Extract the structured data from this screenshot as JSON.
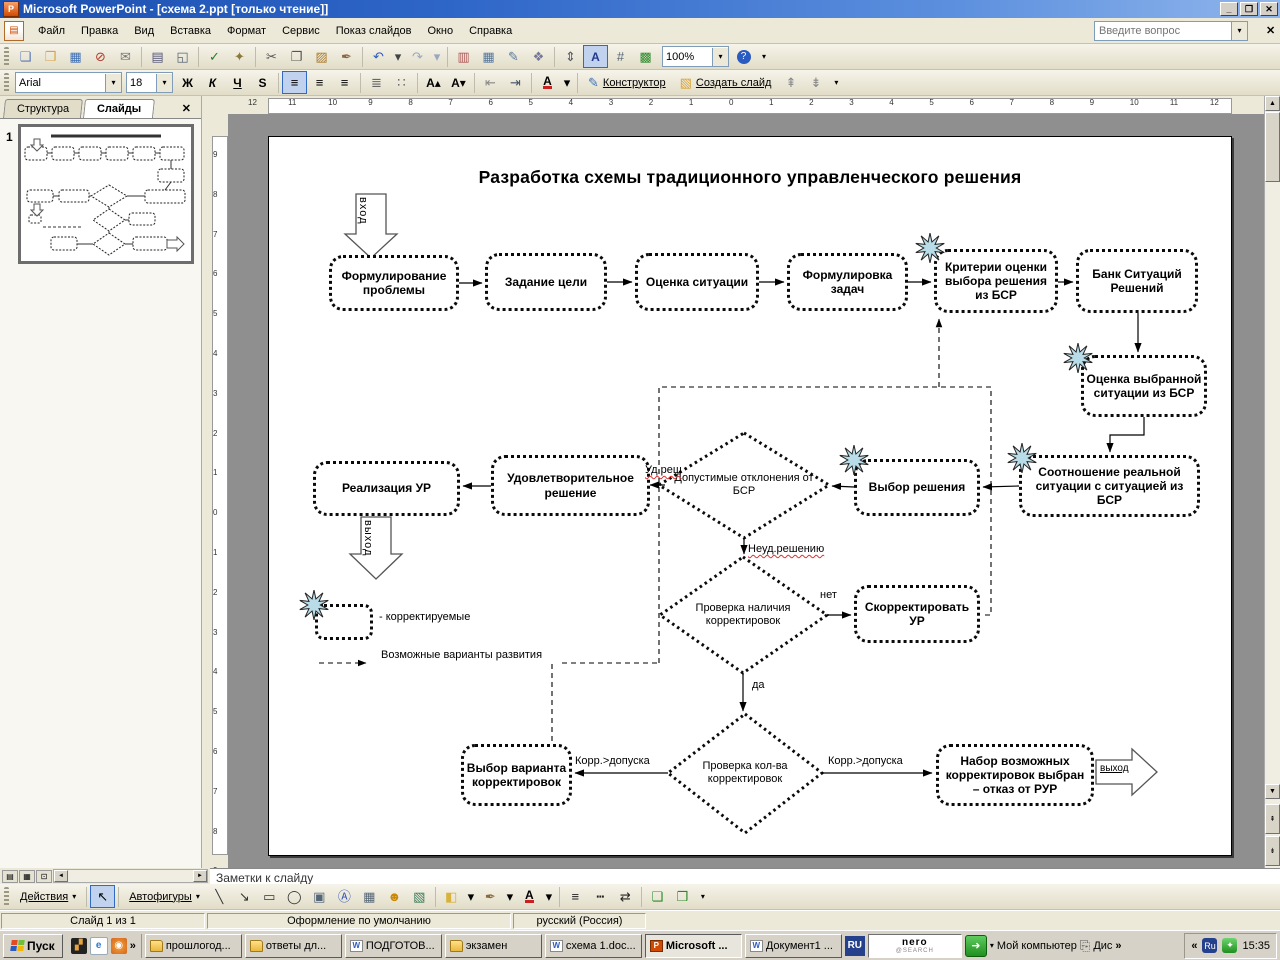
{
  "window": {
    "title": "Microsoft PowerPoint - [схема 2.ppt [только чтение]]"
  },
  "menu": {
    "items": [
      "Файл",
      "Правка",
      "Вид",
      "Вставка",
      "Формат",
      "Сервис",
      "Показ слайдов",
      "Окно",
      "Справка"
    ],
    "question_placeholder": "Введите вопрос"
  },
  "standard_toolbar": {
    "zoom": "100%",
    "buttons": [
      {
        "n": "new-document",
        "g": "❏",
        "c": "#5a77b5"
      },
      {
        "n": "open",
        "g": "❒",
        "c": "#d8a33a"
      },
      {
        "n": "save",
        "g": "▦",
        "c": "#3b6eb5"
      },
      {
        "n": "permission",
        "g": "⊘",
        "c": "#b03a2e"
      },
      {
        "n": "mail",
        "g": "✉",
        "c": "#777777"
      },
      {
        "n": "sep"
      },
      {
        "n": "print",
        "g": "▤",
        "c": "#555577"
      },
      {
        "n": "print-preview",
        "g": "◱",
        "c": "#556677"
      },
      {
        "n": "sep"
      },
      {
        "n": "spelling",
        "g": "✓",
        "c": "#2a7a2a"
      },
      {
        "n": "research",
        "g": "✦",
        "c": "#8a7a3a"
      },
      {
        "n": "sep"
      },
      {
        "n": "cut",
        "g": "✂",
        "c": "#555555"
      },
      {
        "n": "copy",
        "g": "❐",
        "c": "#555555"
      },
      {
        "n": "paste",
        "g": "▨",
        "c": "#a87a2a"
      },
      {
        "n": "format-painter",
        "g": "✒",
        "c": "#886644"
      },
      {
        "n": "sep"
      },
      {
        "n": "undo",
        "g": "↶",
        "c": "#2a5bc0"
      },
      {
        "n": "undo-options",
        "g": "▾",
        "c": "#444444",
        "w": 1
      },
      {
        "n": "redo",
        "g": "↷",
        "c": "#9aa7c0"
      },
      {
        "n": "redo-options",
        "g": "▾",
        "c": "#9aa7c0",
        "w": 1
      },
      {
        "n": "sep"
      },
      {
        "n": "insert-chart",
        "g": "▥",
        "c": "#b05555"
      },
      {
        "n": "insert-table",
        "g": "▦",
        "c": "#557799"
      },
      {
        "n": "draw-table",
        "g": "✎",
        "c": "#557799"
      },
      {
        "n": "insert-object",
        "g": "❖",
        "c": "#777799"
      },
      {
        "n": "sep"
      },
      {
        "n": "line-spacing",
        "g": "⇕",
        "c": "#555566"
      },
      {
        "n": "show-formatting",
        "g": "A",
        "c": "#223a8c",
        "active": 1,
        "cls": "b"
      },
      {
        "n": "grid",
        "g": "#",
        "c": "#556677"
      },
      {
        "n": "color-scheme",
        "g": "▩",
        "c": "#2a8a2a"
      }
    ]
  },
  "formatting_toolbar": {
    "font": "Arial",
    "size": "18",
    "design_label": "Конструктор",
    "new_slide_label": "Создать слайд",
    "buttons": [
      {
        "n": "bold",
        "g": "Ж",
        "cls": "b"
      },
      {
        "n": "italic",
        "g": "К",
        "cls": "i"
      },
      {
        "n": "underline",
        "g": "Ч",
        "cls": "u"
      },
      {
        "n": "text-shadow",
        "g": "S",
        "cls": "b"
      },
      {
        "n": "sep"
      },
      {
        "n": "align-left",
        "g": "≡",
        "active": 1
      },
      {
        "n": "align-center",
        "g": "≡"
      },
      {
        "n": "align-right",
        "g": "≡"
      },
      {
        "n": "sep"
      },
      {
        "n": "numbering",
        "g": "≣",
        "c": "#666666"
      },
      {
        "n": "bullets",
        "g": "∷",
        "c": "#666666"
      },
      {
        "n": "sep"
      },
      {
        "n": "increase-font-size",
        "g": "A▴",
        "cls": "b"
      },
      {
        "n": "decrease-font-size",
        "g": "A▾",
        "cls": "b"
      },
      {
        "n": "sep"
      },
      {
        "n": "decrease-indent",
        "g": "⇤",
        "c": "#888888"
      },
      {
        "n": "increase-indent",
        "g": "⇥",
        "c": "#445566"
      },
      {
        "n": "sep"
      },
      {
        "n": "font-color",
        "g": "А",
        "cls": "fc"
      },
      {
        "n": "font-color-options",
        "g": "▾",
        "w": 1
      }
    ]
  },
  "drawing_toolbar": {
    "actions_label": "Действия",
    "autoshapes_label": "Автофигуры",
    "buttons": [
      {
        "n": "line",
        "g": "╲",
        "c": "#333333"
      },
      {
        "n": "arrow",
        "g": "↘",
        "c": "#333333"
      },
      {
        "n": "rectangle",
        "g": "▭",
        "c": "#333333"
      },
      {
        "n": "oval",
        "g": "◯",
        "c": "#333333"
      },
      {
        "n": "text-box",
        "g": "▣",
        "c": "#556677"
      },
      {
        "n": "wordart",
        "g": "Ⓐ",
        "c": "#3355bb"
      },
      {
        "n": "insert-diagram",
        "g": "▦",
        "c": "#556677"
      },
      {
        "n": "clip-art",
        "g": "☻",
        "c": "#cc8800"
      },
      {
        "n": "insert-picture",
        "g": "▧",
        "c": "#3a7a5a"
      },
      {
        "n": "sep"
      },
      {
        "n": "fill-color",
        "g": "◧",
        "c": "#d8b23a"
      },
      {
        "n": "fill-color-options",
        "g": "▾",
        "w": 1
      },
      {
        "n": "line-color",
        "g": "✒",
        "c": "#8a6a3a"
      },
      {
        "n": "line-color-options",
        "g": "▾",
        "w": 1
      },
      {
        "n": "font-color-draw",
        "g": "А",
        "cls": "fc"
      },
      {
        "n": "font-color-draw-options",
        "g": "▾",
        "w": 1
      },
      {
        "n": "sep"
      },
      {
        "n": "line-style",
        "g": "≡",
        "c": "#222222"
      },
      {
        "n": "dash-style",
        "g": "┅",
        "c": "#222222"
      },
      {
        "n": "arrow-style",
        "g": "⇄",
        "c": "#222222"
      },
      {
        "n": "sep"
      },
      {
        "n": "shadow-style",
        "g": "❏",
        "c": "#2a8a2a"
      },
      {
        "n": "3d-style",
        "g": "❒",
        "c": "#2a8a2a"
      }
    ]
  },
  "panes": {
    "tabs": [
      {
        "label": "Структура"
      },
      {
        "label": "Слайды"
      }
    ],
    "slide_number": "1"
  },
  "rulers": {
    "horizontal": [
      "12",
      "11",
      "10",
      "9",
      "8",
      "7",
      "6",
      "5",
      "4",
      "3",
      "2",
      "1",
      "0",
      "1",
      "2",
      "3",
      "4",
      "5",
      "6",
      "7",
      "8",
      "9",
      "10",
      "11",
      "12"
    ],
    "vertical": [
      "9",
      "8",
      "7",
      "6",
      "5",
      "4",
      "3",
      "2",
      "1",
      "0",
      "1",
      "2",
      "3",
      "4",
      "5",
      "6",
      "7",
      "8",
      "9"
    ]
  },
  "diagram": {
    "title": "Разработка схемы традиционного управленческого решения",
    "entry_label": "вход",
    "exit_down_label": "выход",
    "exit_right_label": "выход",
    "nodes": {
      "formulate_problem": "Формулирование проблемы",
      "set_goal": "Задание цели",
      "assess_situation": "Оценка ситуации",
      "formulate_tasks": "Формулировка задач",
      "criteria": "Критерии оценки выбора решения из БСР",
      "bank": "Банк Ситуаций Решений",
      "evaluate_selected": "Оценка выбранной ситуации из БСР",
      "correlation": "Соотношение реальной ситуации с ситуацией из БСР",
      "implementation": "Реализация УР",
      "satisfactory": "Удовлетворительное решение",
      "allowable_deviations": "Допустимые отклонения от БСР",
      "choose_solution": "Выбор решения",
      "check_corrections": "Проверка наличия корректировок",
      "adjust": "Скорректировать УР",
      "check_quantity": "Проверка кол-ва корректировок",
      "choose_correction_variant": "Выбор варианта корректировок",
      "correction_set": "Набор возможных корректировок выбран – отказ от РУР"
    },
    "labels": {
      "satisfied": "Уд.реш",
      "unsatisfied": "Неуд.решению",
      "no": "нет",
      "yes": "да",
      "corr_left": "Корр.>допуска",
      "corr_right": "Корр.>допуска",
      "legend_correctable": "- корректируемые",
      "legend_variants": "Возможные варианты развития"
    }
  },
  "notes": {
    "placeholder": "Заметки к слайду"
  },
  "status_bar": {
    "slide": "Слайд 1 из 1",
    "design": "Оформление по умолчанию",
    "language": "русский (Россия)"
  },
  "taskbar": {
    "start": "Пуск",
    "tasks": [
      {
        "icon": "folder",
        "label": "прошлогод..."
      },
      {
        "icon": "folder",
        "label": "ответы дл..."
      },
      {
        "icon": "word",
        "label": "ПОДГОТОВ..."
      },
      {
        "icon": "folder",
        "label": "экзамен"
      },
      {
        "icon": "word",
        "label": "схема 1.doc..."
      },
      {
        "icon": "ppt",
        "label": "Microsoft ...",
        "active": 1
      },
      {
        "icon": "word",
        "label": "Документ1 ..."
      }
    ],
    "lang_indicator": "RU",
    "nero_logo": "nero",
    "nero_sub": "@SEARCH",
    "my_computer": "Мой компьютер",
    "disk_label": "Дис",
    "chevron_right": "»",
    "chevron_left": "«",
    "tray_lang": "Ru",
    "time": "15:35"
  }
}
